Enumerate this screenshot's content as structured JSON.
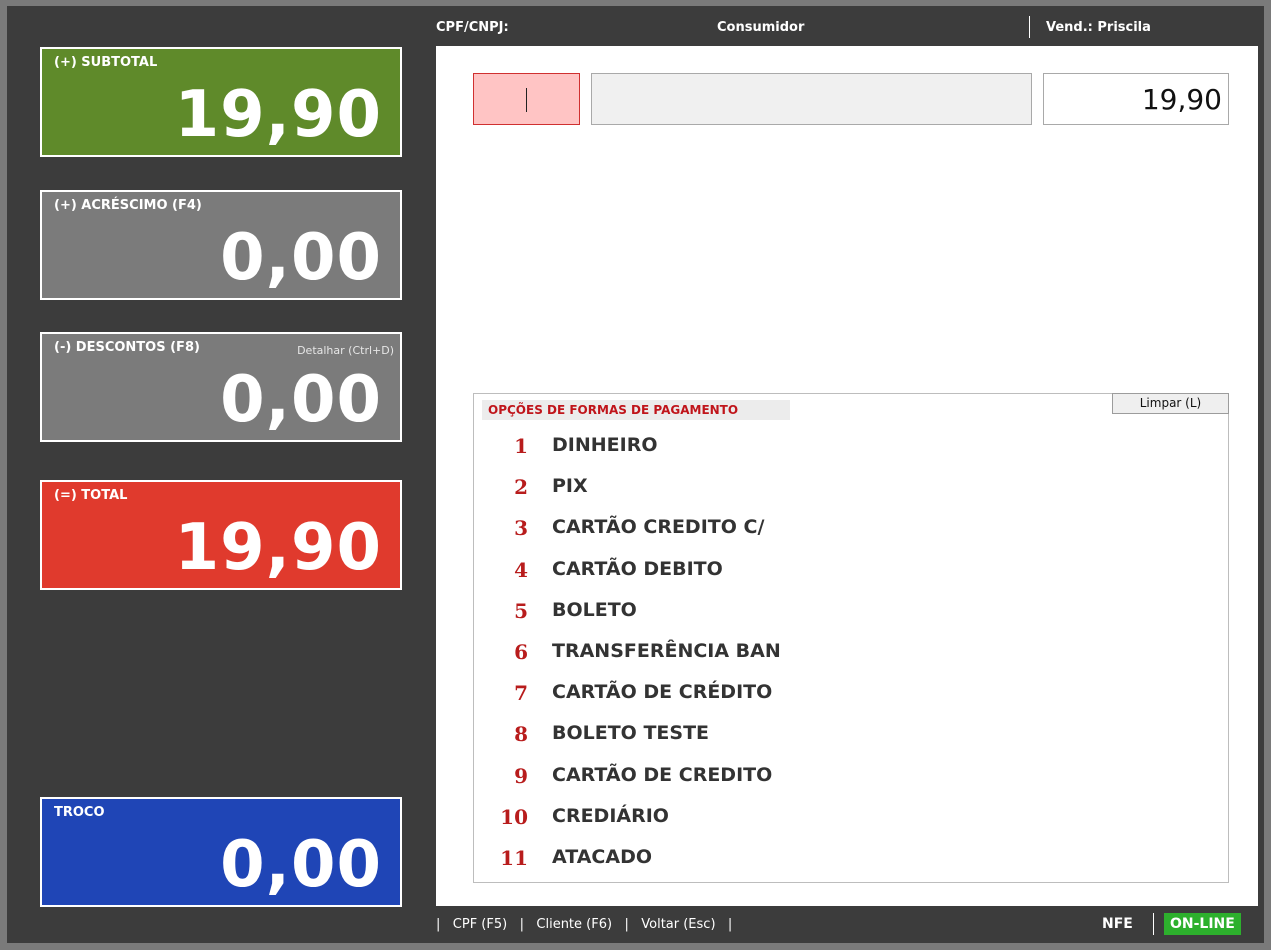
{
  "header": {
    "cpf_label": "CPF/CNPJ:",
    "customer": "Consumidor",
    "seller": "Vend.: Priscila"
  },
  "cards": {
    "subtotal": {
      "label": "(+) SUBTOTAL",
      "value": "19,90"
    },
    "acrescimo": {
      "label": "(+) ACRÉSCIMO  (F4)",
      "value": "0,00"
    },
    "descontos": {
      "label": "(-) DESCONTOS (F8)",
      "detail": "Detalhar (Ctrl+D)",
      "value": "0,00"
    },
    "total": {
      "label": "(=) TOTAL",
      "value": "19,90"
    },
    "troco": {
      "label": "TROCO",
      "value": "0,00"
    }
  },
  "inputs": {
    "code_value": "",
    "description_value": "",
    "amount_value": "19,90"
  },
  "payment": {
    "title": "OPÇÕES DE FORMAS DE PAGAMENTO",
    "clear_label": "Limpar (L)",
    "options": [
      {
        "num": "1",
        "name": "DINHEIRO"
      },
      {
        "num": "2",
        "name": "PIX"
      },
      {
        "num": "3",
        "name": "CARTÃO CREDITO C/"
      },
      {
        "num": "4",
        "name": "CARTÃO DEBITO"
      },
      {
        "num": "5",
        "name": "BOLETO"
      },
      {
        "num": "6",
        "name": "TRANSFERÊNCIA BAN"
      },
      {
        "num": "7",
        "name": "CARTÃO DE CRÉDITO"
      },
      {
        "num": "8",
        "name": "BOLETO TESTE"
      },
      {
        "num": "9",
        "name": "CARTÃO DE CREDITO"
      },
      {
        "num": "10",
        "name": "CREDIÁRIO"
      },
      {
        "num": "11",
        "name": "ATACADO"
      }
    ]
  },
  "footer": {
    "cpf_link": "CPF (F5)",
    "client_link": "Cliente (F6)",
    "back_link": "Voltar (Esc)",
    "doc_type": "NFE",
    "status": "ON-LINE"
  },
  "colors": {
    "subtotal": "#5f8a2a",
    "neutral": "#7b7b7b",
    "total": "#e03a2d",
    "troco": "#1f45b6",
    "online": "#2db02d",
    "accent_red": "#c0151b"
  }
}
